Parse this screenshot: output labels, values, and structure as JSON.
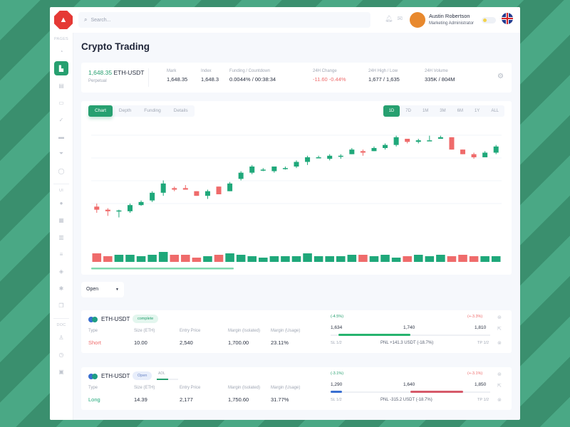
{
  "topbar": {
    "search_placeholder": "Search...",
    "user_name": "Austin Robertson",
    "user_role": "Marketing Administrator",
    "logo_icon": "hexagon-logo-icon"
  },
  "sidebar": {
    "sections": [
      {
        "title": "PAGES",
        "items": [
          "pie-chart-icon",
          "bar-chart-icon",
          "file-icon",
          "folder-icon",
          "check-icon",
          "card-icon",
          "funnel-icon",
          "chat-icon"
        ]
      },
      {
        "title": "UI",
        "items": [
          "user-icon",
          "calendar-icon",
          "chart-icon",
          "list-icon",
          "layers-icon",
          "settings-icon",
          "copy-icon"
        ]
      },
      {
        "title": "DOC",
        "items": [
          "person-icon",
          "clock-icon",
          "box-icon"
        ]
      }
    ],
    "active_index": 1
  },
  "page": {
    "title": "Crypto Trading"
  },
  "ticker": {
    "price": "1,648.35",
    "pair": "ETH-USDT",
    "type": "Perpetual",
    "stats": [
      {
        "label": "Mark",
        "value": "1,648.35"
      },
      {
        "label": "Index",
        "value": "1,648.3"
      },
      {
        "label": "Funding / Countdown",
        "value": "0.0044% / 00:38:34"
      },
      {
        "label": "24H Change",
        "value": "-11.60 -0.44%"
      },
      {
        "label": "24H High / Low",
        "value": "1,677 / 1,635"
      },
      {
        "label": "24H Volume",
        "value": "335K / 804M"
      }
    ]
  },
  "chart_tabs": [
    "Chart",
    "Depth",
    "Funding",
    "Details"
  ],
  "chart_tab_active": 0,
  "ranges": [
    "1D",
    "7D",
    "1M",
    "3M",
    "6M",
    "1Y",
    "ALL"
  ],
  "range_active": 0,
  "colors": {
    "up": "#1fa87a",
    "down": "#ef6b6b",
    "accent": "#27a070"
  },
  "chart_data": {
    "type": "candlestick",
    "title": "ETH-USDT",
    "xlabel": "",
    "ylabel": "",
    "grid": true,
    "candles": [
      [
        30,
        28,
        32,
        26
      ],
      [
        28,
        27,
        29,
        24
      ],
      [
        27,
        27.5,
        28,
        23
      ],
      [
        27,
        31,
        32,
        26
      ],
      [
        31,
        33,
        34,
        30.5
      ],
      [
        34,
        39,
        40,
        33
      ],
      [
        39,
        45,
        47,
        37
      ],
      [
        42,
        41,
        43,
        40
      ],
      [
        42,
        41,
        44,
        41
      ],
      [
        40,
        37,
        40,
        37
      ],
      [
        37,
        40,
        41,
        35
      ],
      [
        43,
        38,
        43,
        38
      ],
      [
        40,
        45,
        46,
        40
      ],
      [
        48,
        52,
        53,
        47
      ],
      [
        52,
        56,
        57,
        51
      ],
      [
        54,
        54,
        55,
        53
      ],
      [
        53,
        56,
        56,
        52
      ],
      [
        55,
        55,
        56,
        54
      ],
      [
        56,
        59,
        60,
        55
      ],
      [
        59,
        62,
        63,
        57
      ],
      [
        62,
        62,
        63,
        62
      ],
      [
        61,
        63,
        64,
        60
      ],
      [
        63,
        63,
        64,
        61
      ],
      [
        64,
        67,
        68,
        64
      ],
      [
        66,
        65,
        67,
        63
      ],
      [
        66,
        68,
        69,
        66
      ],
      [
        68,
        70,
        71,
        67
      ],
      [
        70,
        75,
        76,
        69
      ],
      [
        74,
        72,
        74,
        71
      ],
      [
        72,
        73,
        74,
        71
      ],
      [
        73,
        73,
        76,
        73
      ],
      [
        74,
        75,
        76,
        74
      ],
      [
        75,
        67,
        75,
        67
      ],
      [
        67,
        64,
        67,
        64
      ],
      [
        64,
        62,
        65,
        61
      ],
      [
        62,
        65,
        66,
        62
      ],
      [
        65,
        69,
        70,
        64
      ]
    ],
    "volumes": [
      6,
      4,
      5,
      5,
      4,
      5,
      7,
      5,
      5,
      3,
      4,
      5,
      6,
      5,
      4,
      3,
      4,
      4,
      4,
      6,
      4,
      4,
      4,
      5,
      5,
      4,
      5,
      3,
      4,
      5,
      4,
      5,
      4,
      5,
      4,
      4,
      4
    ],
    "ylim": [
      20,
      80
    ]
  },
  "filter": {
    "value": "Open"
  },
  "positions": [
    {
      "pair": "ETH-USDT",
      "badge": "complete",
      "badge_kind": "green",
      "adl": "",
      "type": "Short",
      "type_kind": "down",
      "size": "10.00",
      "entry": "2,540",
      "margin_iso": "1,700.00",
      "margin_usage": "23.11%",
      "left_pct": "(-4.5%)",
      "right_pct": "(+-3.3%)",
      "low": "1,634",
      "mid": "1,740",
      "high": "1,810",
      "sl": "SL 1/2",
      "pnl": "PNL +141.3 USDT (-18.7%)",
      "tp": "TP 1/2",
      "fill_from": 0.05,
      "fill_to": 0.5,
      "fill_kind": "up"
    },
    {
      "pair": "ETH-USDT",
      "badge": "Open",
      "badge_kind": "blue",
      "adl": "ADL",
      "type": "Long",
      "type_kind": "up",
      "size": "14.39",
      "entry": "2,177",
      "margin_iso": "1,750.60",
      "margin_usage": "31.77%",
      "left_pct": "(-3.1%)",
      "right_pct": "(+-3.1%)",
      "low": "1,290",
      "mid": "1,640",
      "high": "1,850",
      "sl": "SL 1/2",
      "pnl": "PNL -315.2 USDT (-18.7%)",
      "tp": "TP 1/2",
      "fill_from": 0.5,
      "fill_to": 0.83,
      "fill_kind": "down"
    }
  ],
  "labels": {
    "type": "Type",
    "size": "Size (ETH)",
    "entry": "Entry Price",
    "margin_iso": "Margin (Isolated)",
    "margin_usage": "Margin (Usage)"
  }
}
